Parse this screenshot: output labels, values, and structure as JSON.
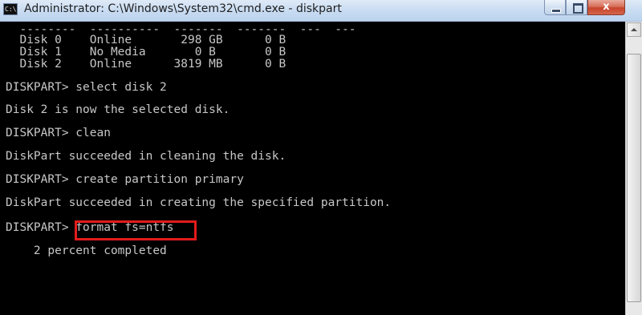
{
  "window": {
    "title": "Administrator: C:\\Windows\\System32\\cmd.exe - diskpart",
    "icon_text": "C:\\",
    "close_glyph": "x"
  },
  "console": {
    "lines": [
      "  --------  ----------  -------  -------  ---  ---",
      "  Disk 0    Online       298 GB      0 B",
      "  Disk 1    No Media       0 B       0 B",
      "  Disk 2    Online      3819 MB      0 B",
      "DISKPART> select disk 2",
      "Disk 2 is now the selected disk.",
      "DISKPART> clean",
      "DiskPart succeeded in cleaning the disk.",
      "DISKPART> create partition primary",
      "DiskPart succeeded in creating the specified partition.",
      "DISKPART> format fs=ntfs",
      "    2 percent completed"
    ]
  },
  "colors": {
    "console_bg": "#000000",
    "console_text": "#c7c7c7",
    "highlight": "#e21b1b"
  }
}
